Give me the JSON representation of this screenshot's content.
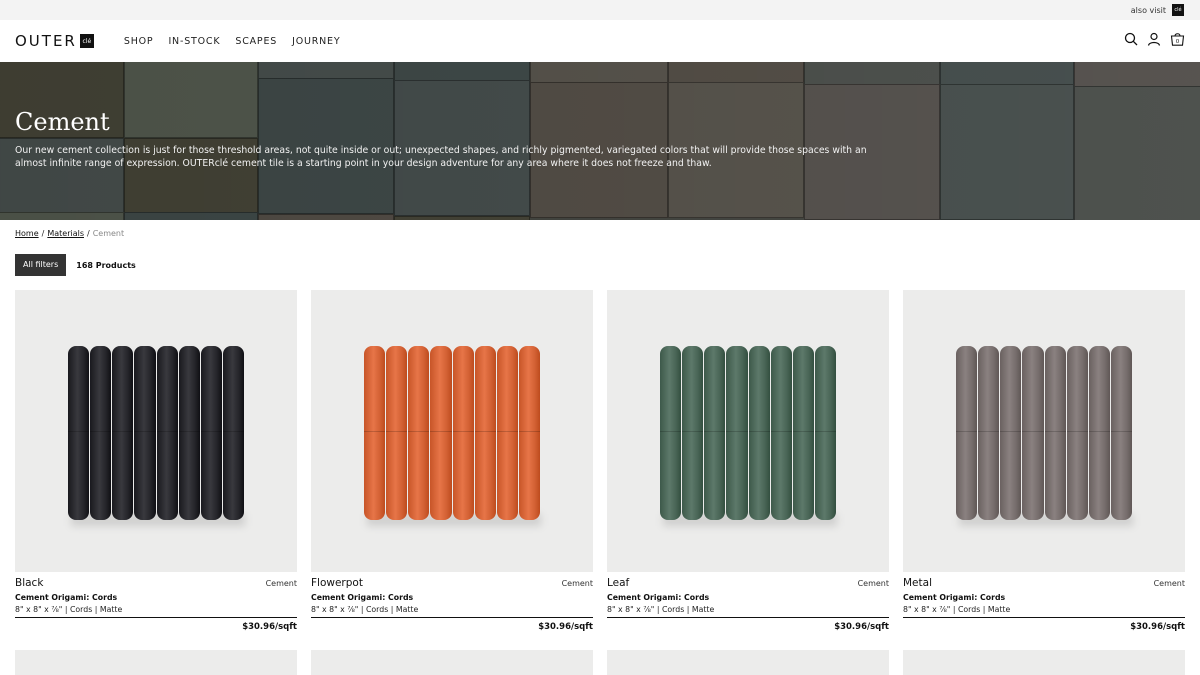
{
  "topbar": {
    "also_visit": "also visit",
    "mini_logo": "clé"
  },
  "brand": {
    "word": "OUTER",
    "box": "clé"
  },
  "nav": [
    {
      "label": "SHOP"
    },
    {
      "label": "IN-STOCK"
    },
    {
      "label": "SCAPES"
    },
    {
      "label": "JOURNEY"
    }
  ],
  "header_icons": {
    "search": "search-icon",
    "account": "user-icon",
    "cart": "cart-icon",
    "cart_count": "0"
  },
  "hero": {
    "title": "Cement",
    "description": "Our new cement collection is just for those threshold areas, not quite inside or out; unexpected shapes, and richly pigmented, variegated colors that will provide those spaces with an almost infinite range of expression. OUTERclé cement tile is a starting point in your design adventure for any area where it does not freeze and thaw."
  },
  "breadcrumb": {
    "home": "Home",
    "sep1": "/",
    "materials": "Materials",
    "sep2": "/",
    "current": "Cement"
  },
  "filters": {
    "all_filters": "All filters",
    "count": "168 Products"
  },
  "products": [
    {
      "name": "Black",
      "material": "Cement",
      "collection": "Cement Origami: Cords",
      "spec": "8\" x 8\" x ⅞\" | Cords | Matte",
      "price": "$30.96/sqft",
      "color": "#2b2b30"
    },
    {
      "name": "Flowerpot",
      "material": "Cement",
      "collection": "Cement Origami: Cords",
      "spec": "8\" x 8\" x ⅞\" | Cords | Matte",
      "price": "$30.96/sqft",
      "color": "#d9673a"
    },
    {
      "name": "Leaf",
      "material": "Cement",
      "collection": "Cement Origami: Cords",
      "spec": "8\" x 8\" x ⅞\" | Cords | Matte",
      "price": "$30.96/sqft",
      "color": "#4f6b5c"
    },
    {
      "name": "Metal",
      "material": "Cement",
      "collection": "Cement Origami: Cords",
      "spec": "8\" x 8\" x ⅞\" | Cords | Matte",
      "price": "$30.96/sqft",
      "color": "#7c7372"
    }
  ],
  "hero_palette": [
    "#4b4a3c",
    "#5a6155",
    "#4e5654",
    "#45504f",
    "#5e5a52",
    "#5a544c",
    "#525652",
    "#4b5453",
    "#5c5854"
  ]
}
